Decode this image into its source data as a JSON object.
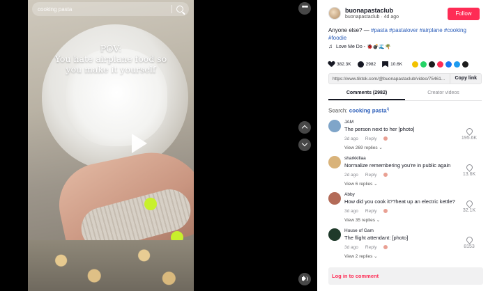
{
  "player": {
    "search_query": "cooking pasta",
    "caption_line1": "POV:",
    "caption_line2": "You hate airplane food so",
    "caption_line3": "you make it yourself",
    "more_label": "•••"
  },
  "post": {
    "author_name": "buonapastaclub",
    "author_sub": "buonapastaclub · 4d ago",
    "follow_label": "Follow",
    "description_text": "Anyone else? — ",
    "hashtags_line1": "#pasta #pastalover #airplane #cooking",
    "hashtags_line2": "#foodie",
    "music": "Love Me Do - 🐞💣🌊🌴",
    "likes": "382.3K",
    "comments": "2982",
    "saves": "10.6K",
    "share_colors": [
      "#f2c200",
      "#25d366",
      "#1d1d1d",
      "#fe2c55",
      "#1877f2",
      "#1d9bf0",
      "#1d1d1d"
    ],
    "link_url": "https://www.tiktok.com/@buonapastaclub/video/754​61...",
    "copy_link": "Copy link"
  },
  "tabs": {
    "comments": "Comments (2982)",
    "creator": "Creator videos"
  },
  "search_hint": {
    "prefix": "Search: ",
    "term": "cooking pasta"
  },
  "comments": [
    {
      "user": "JAM",
      "text": "The person next to her [photo]",
      "time": "3d ago",
      "reply": "Reply",
      "view": "View 269 replies ⌄",
      "likes": "195.6K",
      "avatar_color": "#7fa5c9"
    },
    {
      "user": "sharkkillaa",
      "text": "Normalize remembering you're in public again",
      "time": "2d ago",
      "reply": "Reply",
      "view": "View 6 replies ⌄",
      "likes": "13.6K",
      "avatar_color": "#d9b37a"
    },
    {
      "user": "Abby",
      "text": "How did you cook it??heat up an electric kettle?",
      "time": "3d ago",
      "reply": "Reply",
      "view": "View 35 replies ⌄",
      "likes": "32.1K",
      "avatar_color": "#b36b58"
    },
    {
      "user": "House of Gam",
      "text": "The flight attendant: [photo]",
      "time": "3d ago",
      "reply": "Reply",
      "view": "View 2 replies ⌄",
      "likes": "8153",
      "avatar_color": "#1f3a2a"
    }
  ],
  "login": {
    "label": "Log in to comment"
  }
}
